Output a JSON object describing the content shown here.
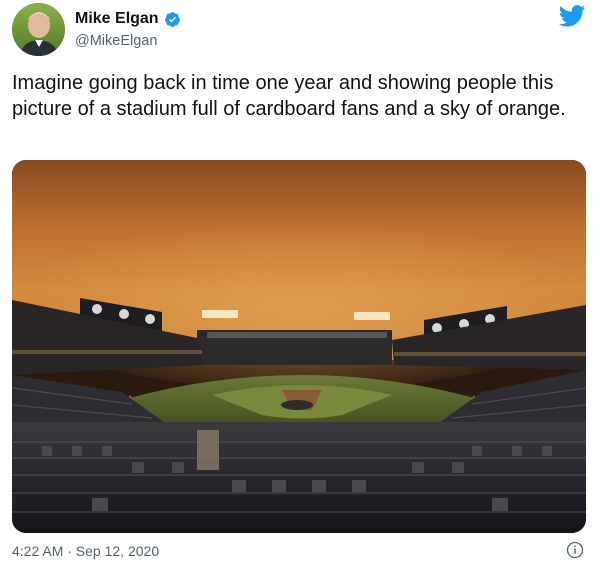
{
  "tweet": {
    "author_name": "Mike Elgan",
    "author_handle": "@MikeElgan",
    "text": "Imagine going back in time one year and showing people this picture of a stadium full of cardboard fans and a sky of orange.",
    "timestamp": "4:22 AM · Sep 12, 2020"
  },
  "icons": {
    "verified": "verified-badge-icon",
    "brand": "twitter-bird-icon",
    "info": "info-icon"
  },
  "colors": {
    "brand_blue": "#1d9bf0",
    "text_primary": "#0f1419",
    "text_secondary": "#536471",
    "sky_orange": "#c9792f"
  }
}
